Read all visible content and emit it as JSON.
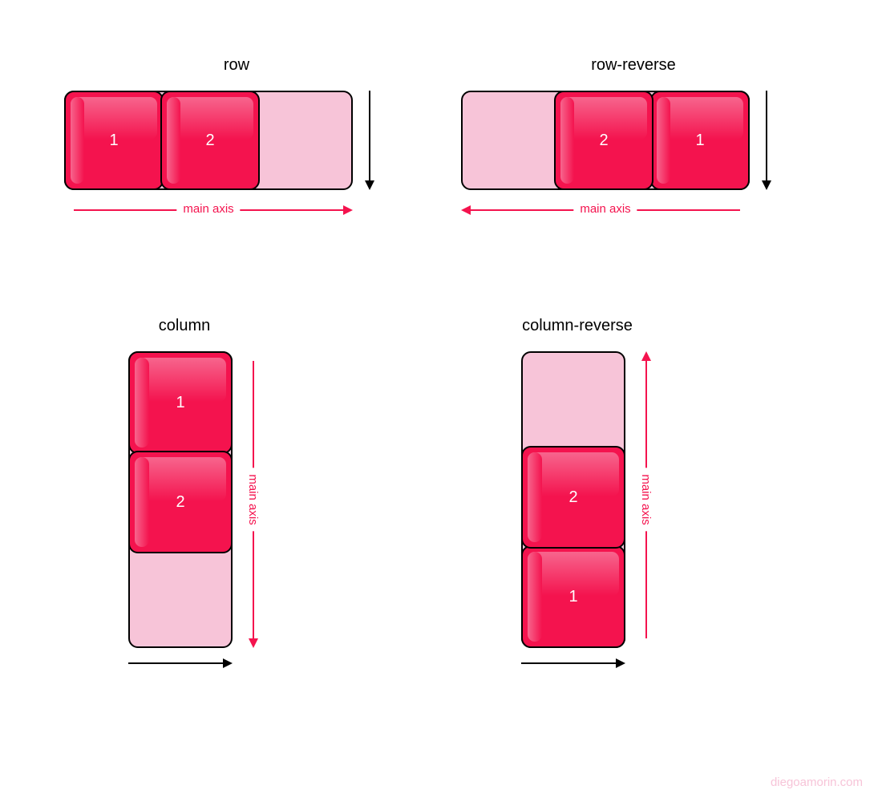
{
  "diagrams": {
    "row": {
      "title": "row",
      "items": [
        "1",
        "2"
      ],
      "main_axis": "main axis",
      "main_dir": "right"
    },
    "row_reverse": {
      "title": "row-reverse",
      "items": [
        "2",
        "1"
      ],
      "main_axis": "main axis",
      "main_dir": "left"
    },
    "column": {
      "title": "column",
      "items": [
        "1",
        "2"
      ],
      "main_axis": "main axis",
      "main_dir": "down"
    },
    "column_reverse": {
      "title": "column-reverse",
      "items": [
        "2",
        "1"
      ],
      "main_axis": "main axis",
      "main_dir": "up"
    }
  },
  "watermark": "diegoamorin.com",
  "colors": {
    "pink_light": "#F7C4D8",
    "pink_dark": "#F4134E",
    "text": "#000"
  }
}
